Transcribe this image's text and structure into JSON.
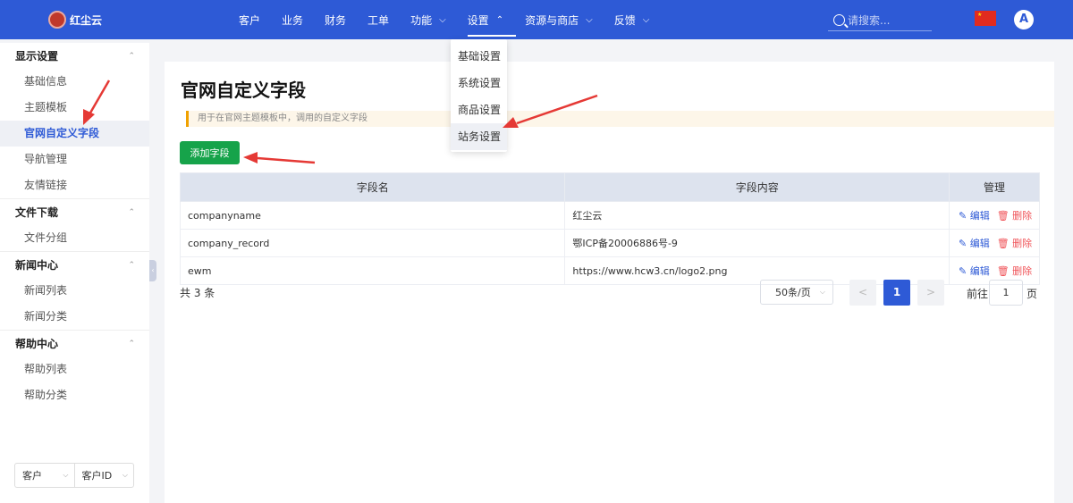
{
  "topbar": {
    "logo_text": "红尘云",
    "nav": [
      {
        "label": "客户",
        "chevron": false
      },
      {
        "label": "业务",
        "chevron": false
      },
      {
        "label": "财务",
        "chevron": false
      },
      {
        "label": "工单",
        "chevron": false
      },
      {
        "label": "功能",
        "chevron": "down"
      },
      {
        "label": "设置",
        "chevron": "up",
        "active": true
      },
      {
        "label": "资源与商店",
        "chevron": "down"
      },
      {
        "label": "反馈",
        "chevron": "down"
      }
    ],
    "search_placeholder": "请搜索...",
    "avatar_letter": "A"
  },
  "settings_dropdown": [
    "基础设置",
    "系统设置",
    "商品设置",
    "站务设置"
  ],
  "sidebar": {
    "groups": [
      {
        "title": "显示设置",
        "items": [
          "基础信息",
          "主题模板",
          "官网自定义字段",
          "导航管理",
          "友情链接"
        ]
      },
      {
        "title": "文件下载",
        "items": [
          "文件分组"
        ]
      },
      {
        "title": "新闻中心",
        "items": [
          "新闻列表",
          "新闻分类"
        ]
      },
      {
        "title": "帮助中心",
        "items": [
          "帮助列表",
          "帮助分类"
        ]
      }
    ],
    "active_item": "官网自定义字段",
    "filter_selects": [
      "客户",
      "客户ID"
    ]
  },
  "main": {
    "title": "官网自定义字段",
    "notice": "用于在官网主题模板中，调用的自定义字段",
    "add_button": "添加字段",
    "table": {
      "headers": [
        "字段名",
        "字段内容",
        "管理"
      ],
      "rows": [
        {
          "name": "companyname",
          "content": "红尘云"
        },
        {
          "name": "company_record",
          "content": "鄂ICP备20006886号-9"
        },
        {
          "name": "ewm",
          "content": "https://www.hcw3.cn/logo2.png"
        }
      ],
      "edit_label": "编辑",
      "delete_label": "删除"
    },
    "total_text": "共 3 条",
    "pagination": {
      "page_size": "50条/页",
      "prev": "<",
      "next": ">",
      "current_page": "1",
      "goto_label": "前往",
      "goto_value": "1",
      "goto_suffix": "页"
    }
  },
  "colors": {
    "primary": "#2e5ad6",
    "success": "#16a34a",
    "danger": "#f0555a",
    "annotation": "#e53935"
  }
}
